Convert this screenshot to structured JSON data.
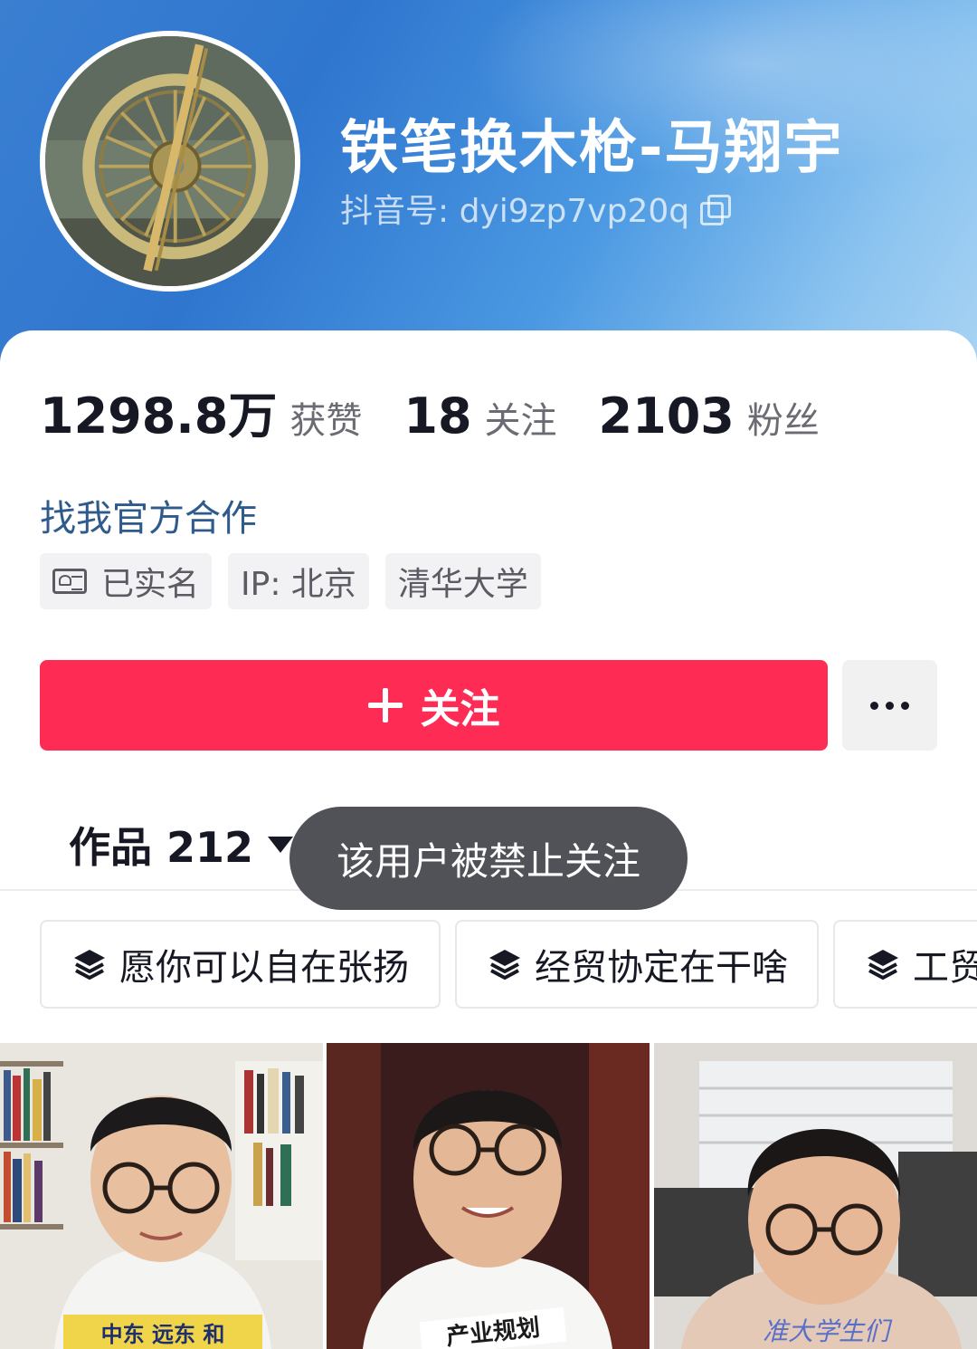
{
  "profile": {
    "nickname": "铁笔换木枪-马翔宇",
    "douyin_id": "抖音号: dyi9zp7vp20q"
  },
  "stats": [
    {
      "value": "1298.8万",
      "label": "获赞"
    },
    {
      "value": "18",
      "label": "关注"
    },
    {
      "value": "2103",
      "label": "粉丝"
    }
  ],
  "official_link": "找我官方合作",
  "tags": {
    "verified": "已实名",
    "ip": "IP: 北京",
    "school": "清华大学"
  },
  "actions": {
    "follow": "关注",
    "more_icon": "more-dots-icon"
  },
  "works_tab": {
    "label": "作品 212"
  },
  "toast": "该用户被禁止关注",
  "collections": [
    "愿你可以自在张扬",
    "经贸协定在干啥",
    "工贸"
  ],
  "thumbnails": [
    {
      "caption": "中东 远东 和"
    },
    {
      "caption": "产业规划"
    },
    {
      "caption": "准大学生们"
    }
  ],
  "colors": {
    "accent": "#fe2c55",
    "link": "#2e5a8c",
    "header": "#3a7fd0"
  }
}
